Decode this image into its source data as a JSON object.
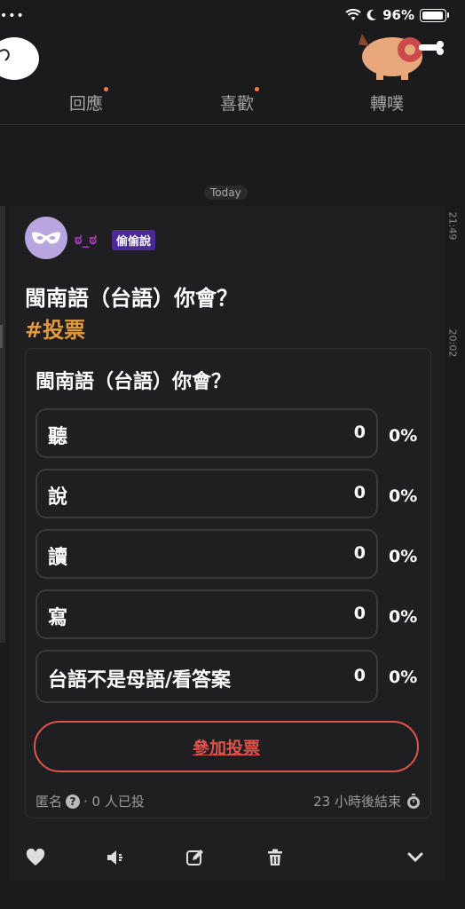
{
  "status_bar": {
    "dots": "•••",
    "battery": "96%"
  },
  "tabs": [
    {
      "label": "回應",
      "dot": true
    },
    {
      "label": "喜歡",
      "dot": true
    },
    {
      "label": "轉噗",
      "dot": false
    }
  ],
  "timeline": {
    "today": "Today",
    "times": [
      "21:49",
      "20:02"
    ]
  },
  "post": {
    "username": "ಠ_ಠ",
    "badge": "偷偷說",
    "title": "閩南語（台語）你會？",
    "tag": "#投票"
  },
  "poll": {
    "question": "閩南語（台語）你會？",
    "options": [
      {
        "label": "聽",
        "count": "0",
        "percent": "0%"
      },
      {
        "label": "說",
        "count": "0",
        "percent": "0%"
      },
      {
        "label": "讀",
        "count": "0",
        "percent": "0%"
      },
      {
        "label": "寫",
        "count": "0",
        "percent": "0%"
      },
      {
        "label": "台語不是母語/看答案",
        "count": "0",
        "percent": "0%"
      }
    ],
    "vote_button": "參加投票",
    "anonymous": "匿名",
    "voters": "· 0 人已投",
    "ends": "23 小時後結束"
  },
  "colors": {
    "accent": "#e0544b",
    "tag": "#e39a3b",
    "badge": "#4b2a98"
  },
  "icons": [
    "heart-icon",
    "speaker-icon",
    "edit-icon",
    "trash-icon",
    "chevron-down-icon"
  ]
}
